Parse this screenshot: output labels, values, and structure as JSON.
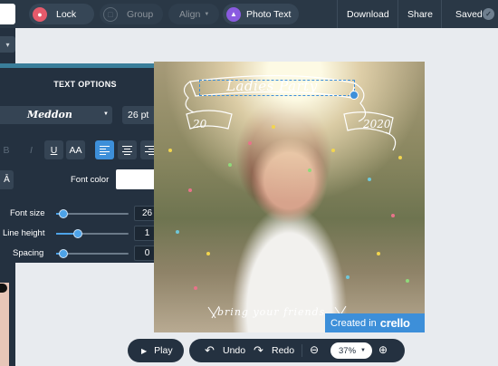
{
  "toolbar": {
    "lock_label": "Lock",
    "group_label": "Group",
    "align_label": "Align",
    "photo_text_label": "Photo Text",
    "download_label": "Download",
    "share_label": "Share",
    "saved_label": "Saved"
  },
  "text_options": {
    "title": "TEXT OPTIONS",
    "font_name": "Meddon",
    "font_size_display": "26 pt",
    "format_buttons": [
      "U",
      "AA"
    ],
    "font_color_label": "Font color",
    "font_color": "#ffffff",
    "a_button_label": "Ā",
    "sliders": [
      {
        "label": "Font size",
        "value": "26",
        "level": 0.1
      },
      {
        "label": "Line height",
        "value": "1",
        "level": 0.3
      },
      {
        "label": "Spacing",
        "value": "0",
        "level": 0.1
      }
    ]
  },
  "icon_column": [
    "text-icon",
    "transparency-icon",
    "layers-icon",
    "duplicate-icon",
    "trash-icon"
  ],
  "canvas": {
    "banner_text": "Ladies Party",
    "year_left": "20",
    "year_right": "2020",
    "bottom_text": "bring your friends",
    "credit_text": "Created in",
    "credit_logo": "crello"
  },
  "playback": {
    "play_label": "Play",
    "undo_label": "Undo",
    "redo_label": "Redo",
    "zoom_value": "37%"
  },
  "colors": {
    "toolbar_bg": "#2a3846",
    "panel_bg": "#243140",
    "accent_blue": "#3d8fd9",
    "lock_red": "#e55a6b",
    "photo_text_purple": "#8a5be0"
  }
}
